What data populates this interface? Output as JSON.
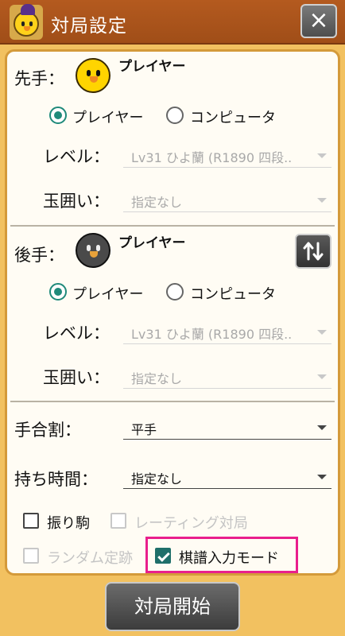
{
  "header": {
    "title": "対局設定",
    "close_icon": "×"
  },
  "sente": {
    "label": "先手：",
    "player_name": "プレイヤー",
    "radio_player": "プレイヤー",
    "radio_computer": "コンピュータ",
    "selected": "player",
    "level_label": "レベル：",
    "level_value": "Lv31 ひよ蘭 (R1890 四段..",
    "castle_label": "玉囲い：",
    "castle_value": "指定なし"
  },
  "gote": {
    "label": "後手：",
    "player_name": "プレイヤー",
    "radio_player": "プレイヤー",
    "radio_computer": "コンピュータ",
    "selected": "player",
    "level_label": "レベル：",
    "level_value": "Lv31 ひよ蘭 (R1890 四段..",
    "castle_label": "玉囲い：",
    "castle_value": "指定なし"
  },
  "handicap": {
    "label": "手合割：",
    "value": "平手"
  },
  "time": {
    "label": "持ち時間：",
    "value": "指定なし"
  },
  "options": {
    "furigoma": {
      "label": "振り駒",
      "checked": false,
      "enabled": true
    },
    "rating": {
      "label": "レーティング対局",
      "checked": false,
      "enabled": false
    },
    "random_joseki": {
      "label": "ランダム定跡",
      "checked": false,
      "enabled": false
    },
    "kifu_input": {
      "label": "棋譜入力モード",
      "checked": true,
      "enabled": true
    }
  },
  "footer": {
    "start_label": "対局開始"
  },
  "colors": {
    "accent": "#1f8a7a",
    "highlight": "#e91e8c",
    "title_bar": "#a04e18",
    "background": "#f2c160"
  },
  "icons": {
    "app": "chick-wizard-icon",
    "close": "close-icon",
    "swap": "swap-vertical-icon"
  }
}
